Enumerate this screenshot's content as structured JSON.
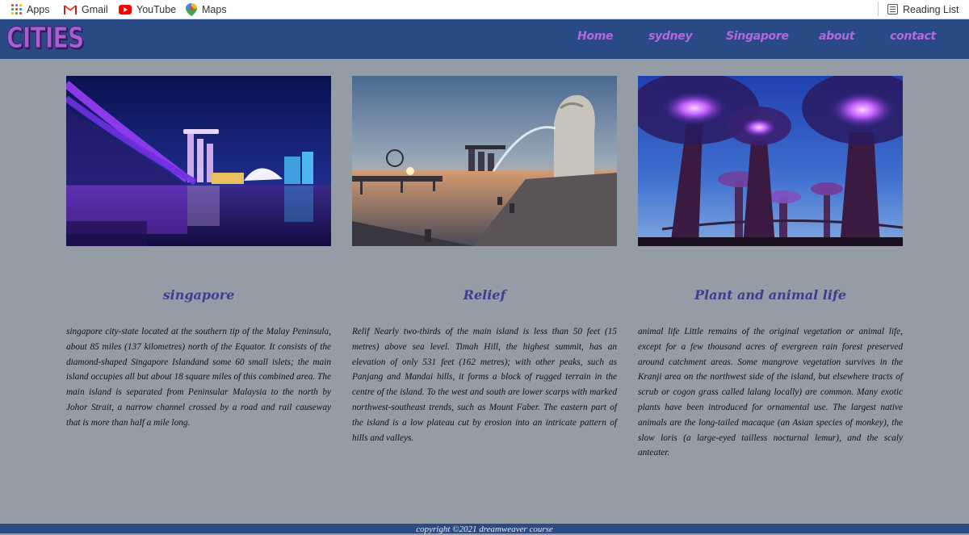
{
  "bookmarks": {
    "apps": "Apps",
    "gmail": "Gmail",
    "youtube": "YouTube",
    "maps": "Maps",
    "reading_list": "Reading List"
  },
  "header": {
    "logo": "CITIES",
    "nav": [
      "Home",
      "sydney",
      "Singapore",
      "about",
      "contact"
    ]
  },
  "columns": [
    {
      "heading": "singapore",
      "body": "singapore city-state located at the southern tip of the Malay Peninsula, about 85 miles (137 kilometres) north of the Equator. It consists of the diamond-shaped Singapore Islandand some 60 small islets; the main island occupies all but about 18 square miles of this combined area. The main island is separated from Peninsular Malaysia to the north by Johor Strait, a narrow channel crossed by a road and rail causeway that is more than half a mile long."
    },
    {
      "heading": "Relief",
      "body": "Relif Nearly two-thirds of the main island is less than 50 feet (15 metres) above sea level. Timah Hill, the highest summit, has an elevation of only 531 feet (162 metres); with other peaks, such as Panjang and Mandai hills, it forms a block of rugged terrain in the centre of the island. To the west and south are lower scarps with marked northwest-southeast trends, such as Mount Faber. The eastern part of the island is a low plateau cut by erosion into an intricate pattern of hills and valleys."
    },
    {
      "heading": "Plant and animal life",
      "body": "animal life Little remains of the original vegetation or animal life, except for a few thousand acres of evergreen rain forest preserved around catchment areas. Some mangrove vegetation survives in the Kranji area on the northwest side of the island, but elsewhere tracts of scrub or cogon grass called lalang locally) are common. Many exotic plants have been introduced for ornamental use. The largest native animals are the long-tailed macaque (an Asian species of monkey), the slow loris (a large-eyed tailless nocturnal lemur), and the scaly anteater."
    }
  ],
  "footer": "copyright ©2021 dreamweaver course",
  "colors": {
    "page_bg": "#949ca6",
    "header_bg": "#2a4a86",
    "nav_link": "#b367e0",
    "heading": "#3a3f90"
  },
  "icons": [
    "apps-grid-icon",
    "gmail-icon",
    "youtube-icon",
    "maps-icon",
    "reading-list-icon"
  ]
}
